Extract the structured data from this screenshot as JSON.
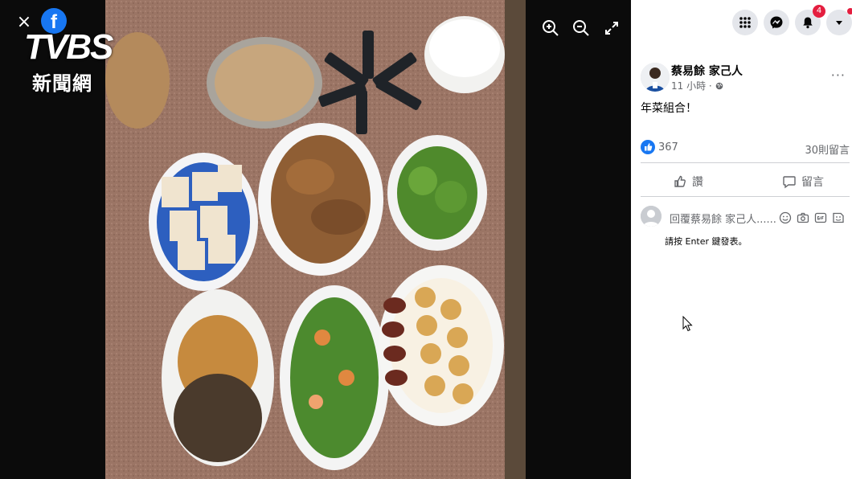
{
  "viewer": {
    "close_label": "×",
    "fb_logo_letter": "f",
    "watermark": {
      "logo": "TVBS",
      "subtitle": "新聞網"
    },
    "tools": [
      "zoom-in-icon",
      "zoom-out-icon",
      "fullscreen-icon"
    ]
  },
  "topbar": {
    "icons": [
      "menu-grid-icon",
      "messenger-icon",
      "notifications-icon",
      "account-caret-icon"
    ],
    "notifications_badge": "4"
  },
  "post": {
    "author": "蔡易餘 家己人",
    "time": "11 小時",
    "privacy_icon": "globe-icon",
    "more": "···",
    "text": "年菜組合！",
    "likes": "367",
    "comments": "30則留言",
    "actions": {
      "like": "讚",
      "comment": "留言"
    }
  },
  "composer": {
    "placeholder": "回覆蔡易餘 家己人......",
    "icons": [
      "emoji-icon",
      "camera-icon",
      "gif-icon",
      "sticker-icon"
    ],
    "hint": "請按 Enter 鍵發表。"
  },
  "colors": {
    "accent": "#1877f2",
    "badge": "#e41e3f",
    "panel_bg": "#ffffff",
    "viewer_bg": "#0b0b0b"
  }
}
